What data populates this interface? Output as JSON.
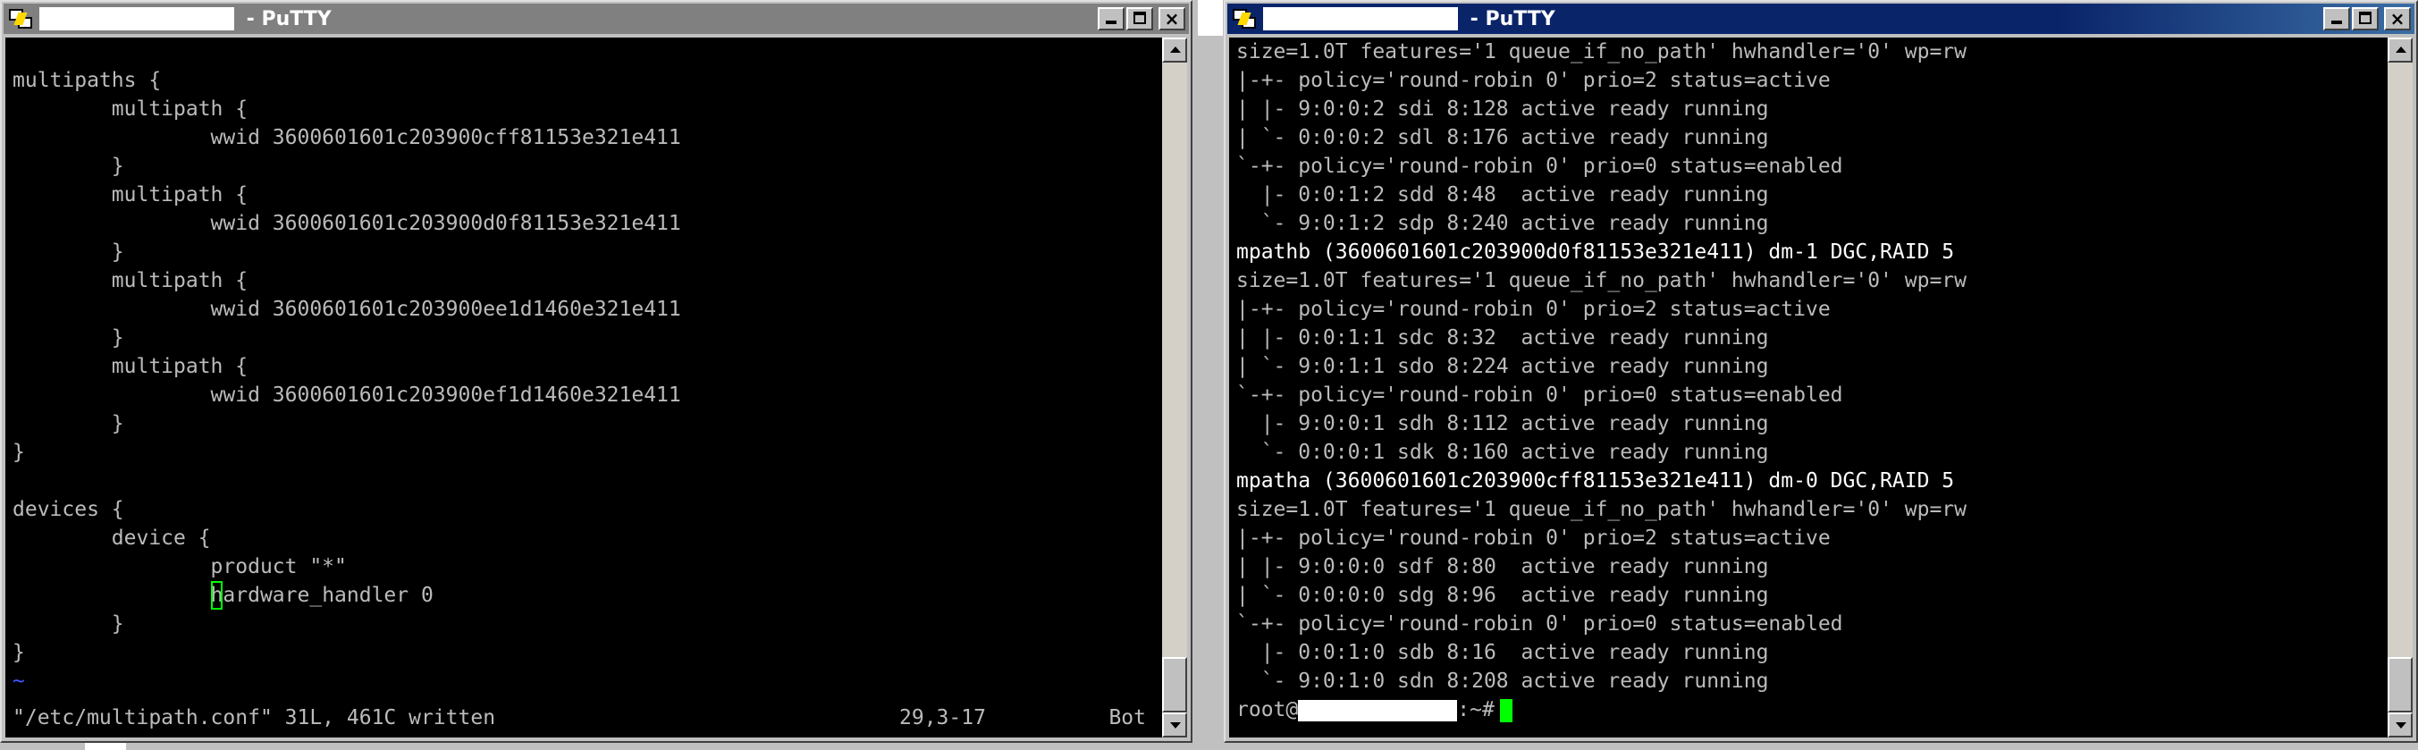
{
  "left_window": {
    "title_suffix": " - PuTTY",
    "lines": [
      "",
      "multipaths {",
      "        multipath {",
      "                wwid 3600601601c203900cff81153e321e411",
      "        }",
      "        multipath {",
      "                wwid 3600601601c203900d0f81153e321e411",
      "        }",
      "        multipath {",
      "                wwid 3600601601c203900ee1d1460e321e411",
      "        }",
      "        multipath {",
      "                wwid 3600601601c203900ef1d1460e321e411",
      "        }",
      "}",
      "",
      "devices {",
      "        device {",
      "                product \"*\""
    ],
    "cursor_line_indent": "                ",
    "cursor_char": "h",
    "cursor_line_rest": "ardware_handler 0",
    "closing_lines": [
      "        }",
      "}"
    ],
    "tilde": "~",
    "status_message": "\"/etc/multipath.conf\" 31L, 461C written",
    "status_position": "29,3-17",
    "status_scroll": "Bot"
  },
  "right_window": {
    "title_suffix": " - PuTTY",
    "lines": [
      {
        "text": "size=1.0T features='1 queue_if_no_path' hwhandler='0' wp=rw",
        "highlight": false
      },
      {
        "text": "|-+- policy='round-robin 0' prio=2 status=active",
        "highlight": false
      },
      {
        "text": "| |- 9:0:0:2 sdi 8:128 active ready running",
        "highlight": false
      },
      {
        "text": "| `- 0:0:0:2 sdl 8:176 active ready running",
        "highlight": false
      },
      {
        "text": "`-+- policy='round-robin 0' prio=0 status=enabled",
        "highlight": false
      },
      {
        "text": "  |- 0:0:1:2 sdd 8:48  active ready running",
        "highlight": false
      },
      {
        "text": "  `- 9:0:1:2 sdp 8:240 active ready running",
        "highlight": false
      },
      {
        "text": "mpathb (3600601601c203900d0f81153e321e411) dm-1 DGC,RAID 5",
        "highlight": true
      },
      {
        "text": "size=1.0T features='1 queue_if_no_path' hwhandler='0' wp=rw",
        "highlight": false
      },
      {
        "text": "|-+- policy='round-robin 0' prio=2 status=active",
        "highlight": false
      },
      {
        "text": "| |- 0:0:1:1 sdc 8:32  active ready running",
        "highlight": false
      },
      {
        "text": "| `- 9:0:1:1 sdo 8:224 active ready running",
        "highlight": false
      },
      {
        "text": "`-+- policy='round-robin 0' prio=0 status=enabled",
        "highlight": false
      },
      {
        "text": "  |- 9:0:0:1 sdh 8:112 active ready running",
        "highlight": false
      },
      {
        "text": "  `- 0:0:0:1 sdk 8:160 active ready running",
        "highlight": false
      },
      {
        "text": "mpatha (3600601601c203900cff81153e321e411) dm-0 DGC,RAID 5",
        "highlight": true
      },
      {
        "text": "size=1.0T features='1 queue_if_no_path' hwhandler='0' wp=rw",
        "highlight": false
      },
      {
        "text": "|-+- policy='round-robin 0' prio=2 status=active",
        "highlight": false
      },
      {
        "text": "| |- 9:0:0:0 sdf 8:80  active ready running",
        "highlight": false
      },
      {
        "text": "| `- 0:0:0:0 sdg 8:96  active ready running",
        "highlight": false
      },
      {
        "text": "`-+- policy='round-robin 0' prio=0 status=enabled",
        "highlight": false
      },
      {
        "text": "  |- 0:0:1:0 sdb 8:16  active ready running",
        "highlight": false
      },
      {
        "text": "  `- 9:0:1:0 sdn 8:208 active ready running",
        "highlight": false
      }
    ],
    "prompt_user": "root@",
    "prompt_suffix": ":~#"
  },
  "colors": {
    "terminal_bg": "#000000",
    "terminal_fg": "#bbbbbb",
    "cursor": "#00ff00",
    "active_title": "#0a246a",
    "inactive_title": "#808080"
  }
}
